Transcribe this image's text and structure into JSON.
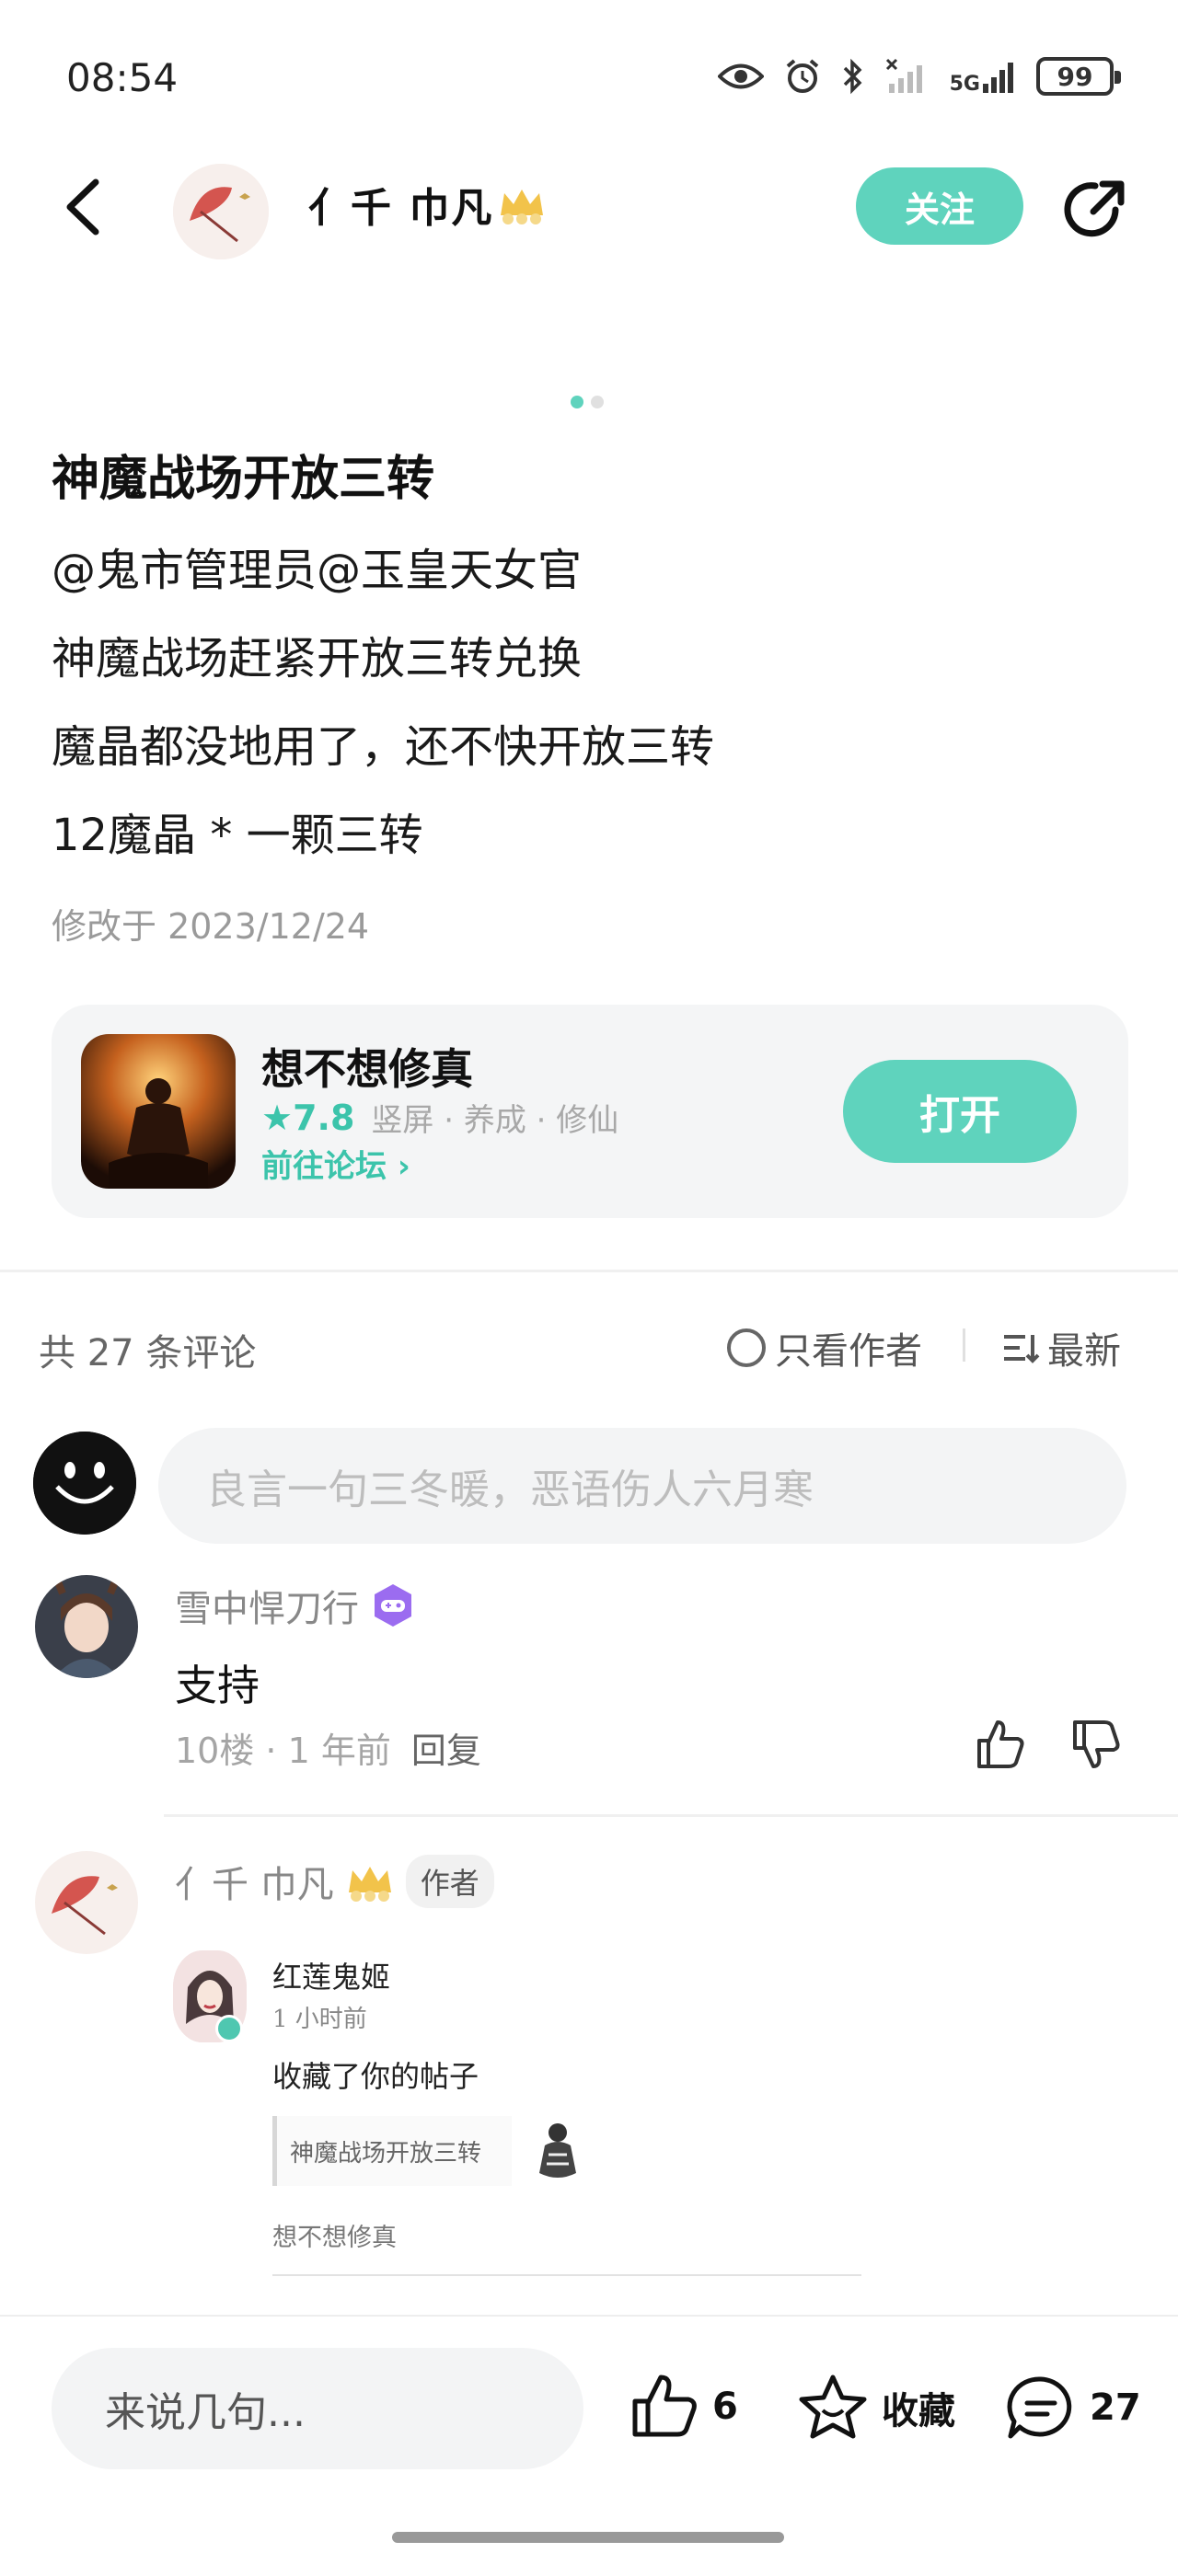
{
  "status_bar": {
    "time": "08:54",
    "signal_label": "5G",
    "battery": "99"
  },
  "header": {
    "author_name": "亻千 巾凡",
    "follow_label": "关注"
  },
  "post": {
    "title": "神魔战场开放三转",
    "lines": [
      "@鬼市管理员@玉皇天女官",
      "神魔战场赶紧开放三转兑换",
      "魔晶都没地用了，还不快开放三转",
      "12魔晶 * 一颗三转"
    ],
    "modified": "修改于 2023/12/24"
  },
  "game_card": {
    "name": "想不想修真",
    "rating": "★7.8",
    "tags": "竖屏 · 养成 · 修仙",
    "forum_link": "前往论坛 ›",
    "open_label": "打开"
  },
  "comments_header": {
    "count": "共 27 条评论",
    "author_only": "只看作者",
    "sort": "最新"
  },
  "comment_input": {
    "placeholder": "良言一句三冬暖，恶语伤人六月寒"
  },
  "comments": [
    {
      "name": "雪中悍刀行",
      "text": "支持",
      "meta": "10楼 · 1 年前",
      "reply": "回复"
    },
    {
      "name": "亻千 巾凡",
      "author_badge": "作者",
      "embed": {
        "name": "红莲鬼姬",
        "time": "1 小时前",
        "message": "收藏了你的帖子",
        "quote": "神魔战场开放三转",
        "source": "想不想修真"
      }
    }
  ],
  "bottom_bar": {
    "input_placeholder": "来说几句...",
    "like_count": "6",
    "favorite_label": "收藏",
    "comment_count": "27"
  },
  "colors": {
    "accent": "#5fd3bd",
    "accent_text": "#3cc4ab"
  }
}
